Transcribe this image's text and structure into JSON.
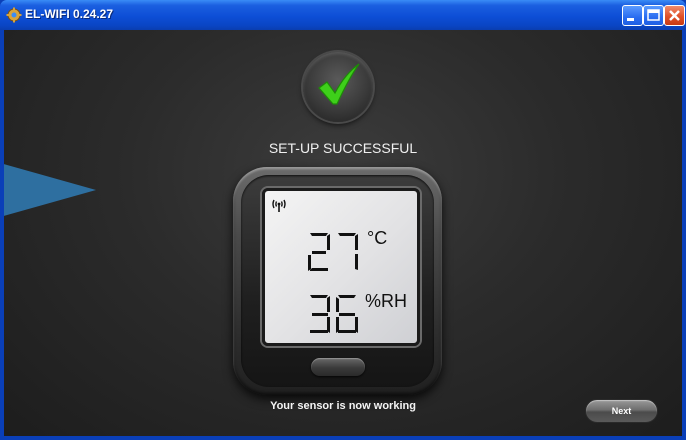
{
  "window": {
    "title": "EL-WIFI 0.24.27"
  },
  "status": {
    "title": "SET-UP SUCCESSFUL",
    "caption": "Your sensor is now working"
  },
  "device": {
    "temperature": "27",
    "temperature_unit": "°C",
    "humidity": "36",
    "humidity_unit": "%RH"
  },
  "actions": {
    "next_label": "Next"
  },
  "colors": {
    "check": "#3ecf1a",
    "arrow": "#2e6fa0",
    "titlebar": "#0d4ed6"
  }
}
